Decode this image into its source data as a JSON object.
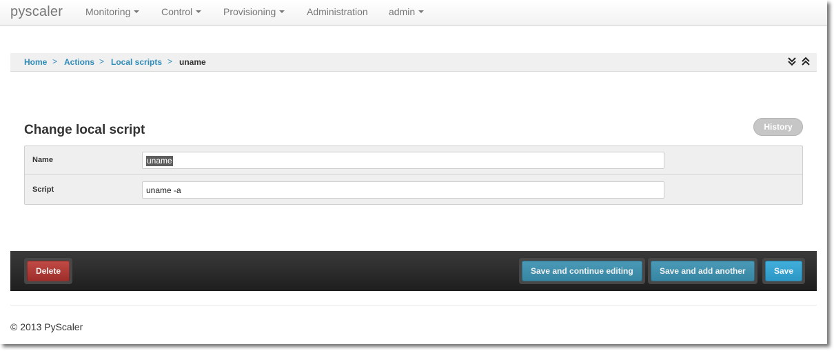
{
  "navbar": {
    "brand": "pyscaler",
    "items": [
      {
        "label": "Monitoring",
        "dropdown": true
      },
      {
        "label": "Control",
        "dropdown": true
      },
      {
        "label": "Provisioning",
        "dropdown": true
      },
      {
        "label": "Administration",
        "dropdown": false
      },
      {
        "label": "admin",
        "dropdown": true
      }
    ]
  },
  "breadcrumb": {
    "items": [
      "Home",
      "Actions",
      "Local scripts"
    ],
    "current": "uname",
    "separator": ">",
    "icons": [
      "double-chevron-down-icon",
      "double-chevron-up-icon"
    ]
  },
  "form": {
    "title": "Change local script",
    "history_label": "History",
    "fields": [
      {
        "label": "Name",
        "value": "uname",
        "selected": true
      },
      {
        "label": "Script",
        "value": "uname -a",
        "selected": false
      }
    ]
  },
  "actions": {
    "delete_label": "Delete",
    "save_continue_label": "Save and continue editing",
    "save_add_label": "Save and add another",
    "save_label": "Save"
  },
  "footer": {
    "text": "© 2013 PyScaler"
  },
  "colors": {
    "link": "#2f8bb8",
    "delete": "#b03b37",
    "save_secondary": "#3f8fad",
    "save_primary": "#36a3d0",
    "action_bar": "#2a2a2a"
  }
}
